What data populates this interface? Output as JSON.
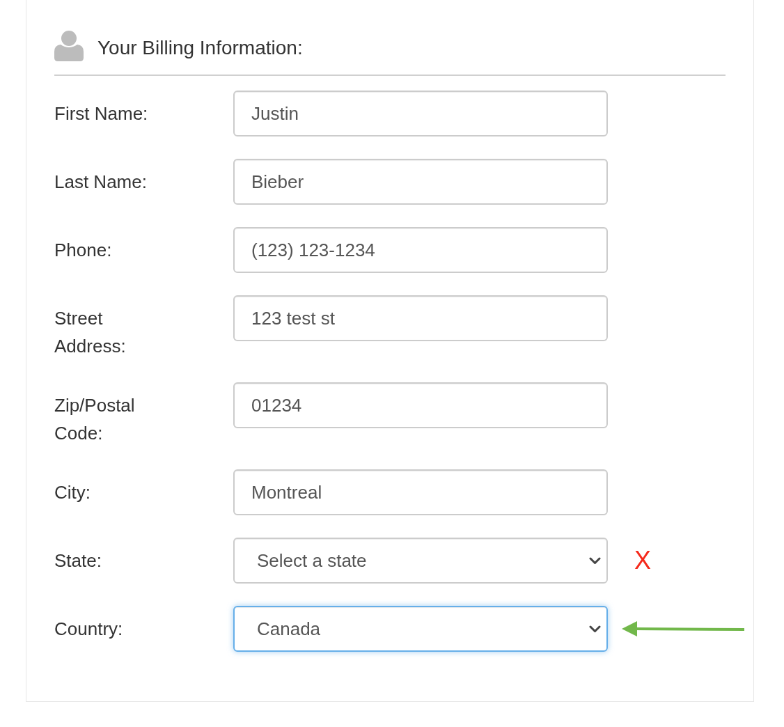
{
  "header": {
    "title": "Your Billing Information:"
  },
  "fields": [
    {
      "kind": "text",
      "label": "First Name:",
      "value": "Justin",
      "focused": false
    },
    {
      "kind": "text",
      "label": "Last Name:",
      "value": "Bieber",
      "focused": false
    },
    {
      "kind": "text",
      "label": "Phone:",
      "value": "(123) 123-1234",
      "focused": false
    },
    {
      "kind": "text",
      "label": "Street Address:",
      "value": "123 test st",
      "focused": false
    },
    {
      "kind": "text",
      "label": "Zip/Postal Code:",
      "value": "01234",
      "focused": false
    },
    {
      "kind": "text",
      "label": "City:",
      "value": "Montreal",
      "focused": false
    },
    {
      "kind": "select",
      "label": "State:",
      "value": "Select a state",
      "focused": false,
      "annotation": {
        "kind": "cross",
        "text": "X"
      }
    },
    {
      "kind": "select",
      "label": "Country:",
      "value": "Canada",
      "focused": true,
      "annotation": {
        "kind": "arrow"
      }
    }
  ]
}
